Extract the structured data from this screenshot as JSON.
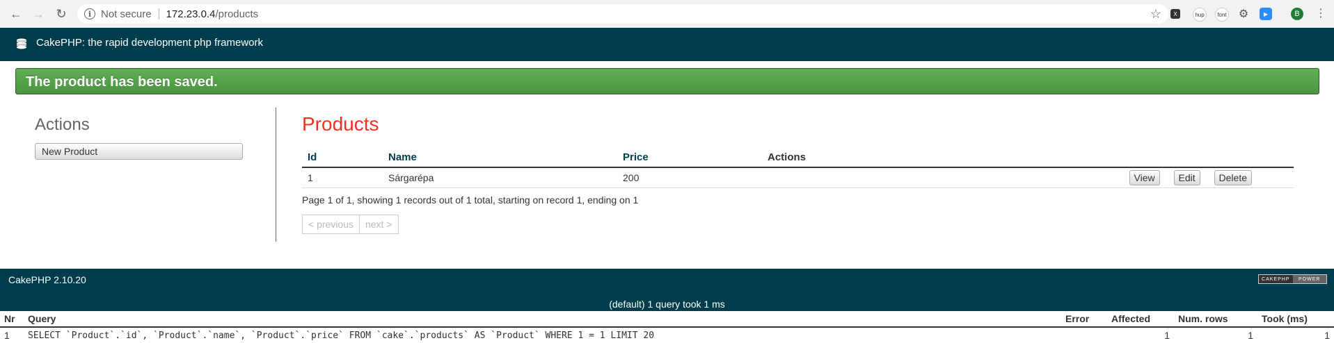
{
  "browser": {
    "secure_label": "Not secure",
    "url_host": "172.23.0.4",
    "url_path": "/products",
    "extensions": [
      {
        "name": "x-extension-icon",
        "label": "X"
      },
      {
        "name": "hup-extension-icon",
        "label": "hup"
      },
      {
        "name": "font-extension-icon",
        "label": "font"
      },
      {
        "name": "gear-extension-icon",
        "label": "⚙"
      },
      {
        "name": "zoom-extension-icon",
        "label": "▶"
      },
      {
        "name": "profile-avatar",
        "label": "B"
      }
    ]
  },
  "header": {
    "title": "CakePHP: the rapid development php framework"
  },
  "flash": {
    "message": "The product has been saved."
  },
  "sidebar": {
    "heading": "Actions",
    "new_product_label": "New Product"
  },
  "main": {
    "heading": "Products",
    "columns": [
      "Id",
      "Name",
      "Price",
      "Actions"
    ],
    "rows": [
      {
        "id": "1",
        "name": "Sárgarépa",
        "price": "200",
        "actions": [
          "View",
          "Edit",
          "Delete"
        ]
      }
    ],
    "paging_text": "Page 1 of 1, showing 1 records out of 1 total, starting on record 1, ending on 1",
    "prev_label": "< previous",
    "next_label": "next >"
  },
  "footer": {
    "version": "CakePHP 2.10.20",
    "badge_left": "CAKEPHP",
    "badge_right": "POWER"
  },
  "sql_log": {
    "caption": "(default) 1 query took 1 ms",
    "columns": [
      "Nr",
      "Query",
      "Error",
      "Affected",
      "Num. rows",
      "Took (ms)"
    ],
    "rows": [
      {
        "nr": "1",
        "query": "SELECT `Product`.`id`, `Product`.`name`, `Product`.`price` FROM `cake`.`products` AS `Product` WHERE 1 = 1 LIMIT 20",
        "error": "",
        "affected": "1",
        "num_rows": "1",
        "took": "1"
      }
    ]
  },
  "colors": {
    "header_bg": "#003d4c",
    "flash_bg": "#4a9440",
    "heading_red": "#e32"
  }
}
